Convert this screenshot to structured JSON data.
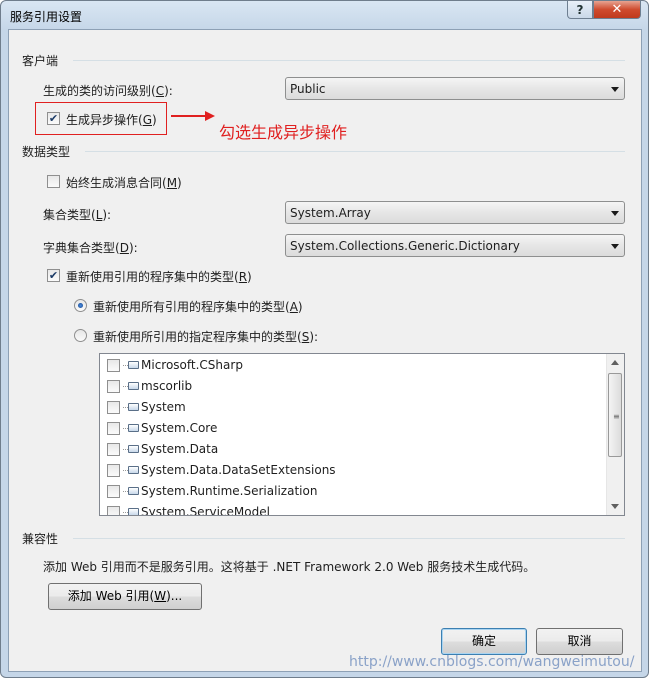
{
  "window": {
    "title": "服务引用设置",
    "help_glyph": "?",
    "close_glyph": "✕"
  },
  "client_section": {
    "group_title": "客户端",
    "access_level_label": "生成的类的访问级别(",
    "access_level_key": "C",
    "access_level_suffix": "):",
    "access_level_value": "Public",
    "async_checkbox_label": "生成异步操作(",
    "async_checkbox_key": "G",
    "async_checkbox_suffix": ")",
    "async_checked": true
  },
  "annotation": {
    "text": "勾选生成异步操作",
    "color": "#e02020"
  },
  "data_types": {
    "group_title": "数据类型",
    "always_message_contracts_label": "始终生成消息合同(",
    "always_message_contracts_key": "M",
    "always_message_contracts_suffix": ")",
    "always_message_contracts_checked": false,
    "collection_type_label": "集合类型(",
    "collection_type_key": "L",
    "collection_type_suffix": "):",
    "collection_type_value": "System.Array",
    "dictionary_type_label": "字典集合类型(",
    "dictionary_type_key": "D",
    "dictionary_type_suffix": "):",
    "dictionary_type_value": "System.Collections.Generic.Dictionary",
    "reuse_types_label": "重新使用引用的程序集中的类型(",
    "reuse_types_key": "R",
    "reuse_types_suffix": ")",
    "reuse_types_checked": true,
    "reuse_all_label": "重新使用所有引用的程序集中的类型(",
    "reuse_all_key": "A",
    "reuse_all_suffix": ")",
    "reuse_all_selected": true,
    "reuse_specified_label": "重新使用所引用的指定程序集中的类型(",
    "reuse_specified_key": "S",
    "reuse_specified_suffix": "):",
    "reuse_specified_selected": false,
    "assemblies": [
      "Microsoft.CSharp",
      "mscorlib",
      "System",
      "System.Core",
      "System.Data",
      "System.Data.DataSetExtensions",
      "System.Runtime.Serialization",
      "System.ServiceModel"
    ]
  },
  "compatibility": {
    "group_title": "兼容性",
    "description": "添加 Web 引用而不是服务引用。这将基于 .NET Framework 2.0 Web 服务技术生成代码。",
    "add_web_ref_label": "添加 Web 引用(",
    "add_web_ref_key": "W",
    "add_web_ref_suffix": ")..."
  },
  "footer": {
    "ok_label": "确定",
    "cancel_label": "取消",
    "watermark": "http://www.cnblogs.com/wangweimutou/"
  }
}
